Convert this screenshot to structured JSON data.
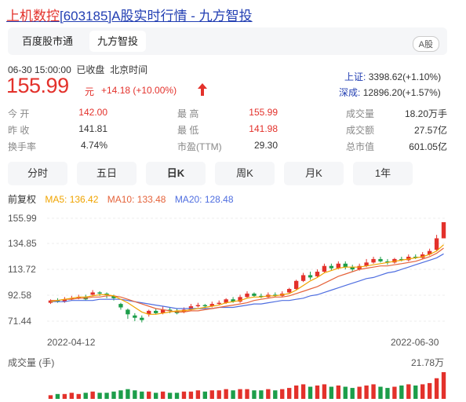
{
  "title": {
    "code_name": "上机数控",
    "bracket": "[603185]A股实时行情 - 九方智投"
  },
  "source_tabs": [
    "百度股市通",
    "九方智投"
  ],
  "market_badge": "A股",
  "quote": {
    "datetime": "06-30 15:00:00",
    "status": "已收盘",
    "timezone": "北京时间",
    "price": "155.99",
    "unit": "元",
    "change": "+14.18 (+10.00%)"
  },
  "indices": [
    {
      "label": "上证:",
      "value": "3398.62(+1.10%)"
    },
    {
      "label": "深成:",
      "value": "12896.20(+1.57%)"
    }
  ],
  "stats": [
    [
      {
        "label": "今  开",
        "value": "142.00",
        "tone": "red"
      },
      {
        "label": "最  高",
        "value": "155.99",
        "tone": "red"
      },
      {
        "label": "成交量",
        "value": "18.20万手",
        "tone": "dark"
      }
    ],
    [
      {
        "label": "昨  收",
        "value": "141.81",
        "tone": "dark"
      },
      {
        "label": "最  低",
        "value": "141.98",
        "tone": "red"
      },
      {
        "label": "成交额",
        "value": "27.57亿",
        "tone": "dark"
      }
    ],
    [
      {
        "label": "换手率",
        "value": "4.74%",
        "tone": "dark"
      },
      {
        "label": "市盈(TTM)",
        "value": "29.30",
        "tone": "dark"
      },
      {
        "label": "总市值",
        "value": "601.05亿",
        "tone": "dark"
      }
    ]
  ],
  "periods": [
    "分时",
    "五日",
    "日K",
    "周K",
    "月K",
    "1年"
  ],
  "active_period": "日K",
  "ma": {
    "adjust": "前复权",
    "ma5": "MA5: 136.42",
    "ma10": "MA10: 133.48",
    "ma20": "MA20: 128.48"
  },
  "colors": {
    "up": "#e3312b",
    "down": "#1c9e4a",
    "ma5": "#f0a400",
    "ma10": "#e5633b",
    "ma20": "#4f6ee0"
  },
  "chart_data": {
    "type": "candlestick",
    "y_ticks": [
      "155.99",
      "134.85",
      "113.72",
      "92.58",
      "71.44"
    ],
    "ylim": [
      71.44,
      155.99
    ],
    "x_labels": [
      "2022-04-12",
      "2022-06-30"
    ],
    "candles": [
      [
        86,
        88,
        89,
        85
      ],
      [
        88,
        87,
        90,
        86
      ],
      [
        87,
        89,
        91,
        86
      ],
      [
        89,
        90,
        92,
        88
      ],
      [
        90,
        91,
        93,
        89
      ],
      [
        91,
        89,
        93,
        88
      ],
      [
        93,
        95,
        97,
        92
      ],
      [
        95,
        94,
        96,
        92
      ],
      [
        94,
        93,
        95,
        90
      ],
      [
        92,
        90,
        93,
        88
      ],
      [
        85,
        82,
        86,
        80
      ],
      [
        80,
        76,
        81,
        72
      ],
      [
        75,
        73,
        77,
        70
      ],
      [
        73,
        71,
        75,
        69
      ],
      [
        76,
        79,
        80,
        74
      ],
      [
        79,
        77,
        81,
        76
      ],
      [
        77,
        80,
        83,
        76
      ],
      [
        80,
        79,
        82,
        77
      ],
      [
        79,
        77,
        81,
        76
      ],
      [
        78,
        80,
        82,
        77
      ],
      [
        80,
        83,
        85,
        79
      ],
      [
        83,
        84,
        86,
        82
      ],
      [
        84,
        83,
        85,
        81
      ],
      [
        83,
        85,
        87,
        82
      ],
      [
        85,
        86,
        88,
        84
      ],
      [
        86,
        89,
        90,
        85
      ],
      [
        89,
        87,
        91,
        86
      ],
      [
        87,
        91,
        93,
        86
      ],
      [
        91,
        94,
        96,
        90
      ],
      [
        94,
        92,
        95,
        91
      ],
      [
        92,
        91,
        94,
        90
      ],
      [
        91,
        93,
        95,
        90
      ],
      [
        93,
        92,
        95,
        91
      ],
      [
        92,
        94,
        96,
        91
      ],
      [
        95,
        98,
        99,
        94
      ],
      [
        98,
        105,
        106,
        97
      ],
      [
        105,
        110,
        112,
        104
      ],
      [
        110,
        108,
        113,
        106
      ],
      [
        109,
        113,
        115,
        108
      ],
      [
        113,
        118,
        120,
        112
      ],
      [
        118,
        116,
        120,
        114
      ],
      [
        116,
        120,
        122,
        115
      ],
      [
        120,
        117,
        122,
        115
      ],
      [
        117,
        115,
        119,
        113
      ],
      [
        115,
        118,
        120,
        114
      ],
      [
        118,
        121,
        124,
        117
      ],
      [
        121,
        124,
        126,
        120
      ],
      [
        124,
        122,
        126,
        121
      ],
      [
        122,
        121,
        124,
        119
      ],
      [
        121,
        124,
        125,
        120
      ],
      [
        124,
        123,
        126,
        122
      ],
      [
        123,
        126,
        128,
        122
      ],
      [
        126,
        125,
        128,
        124
      ],
      [
        125,
        128,
        130,
        124
      ],
      [
        128,
        131,
        133,
        127
      ],
      [
        132,
        142,
        145,
        131
      ],
      [
        142,
        156,
        156,
        142
      ]
    ],
    "ma5": [
      87,
      88,
      89,
      90,
      91,
      91,
      92,
      93,
      93,
      92,
      89,
      86,
      82,
      78,
      76,
      76,
      77,
      78,
      79,
      79,
      80,
      81,
      82,
      83,
      84,
      86,
      87,
      88,
      90,
      91,
      91,
      92,
      92,
      93,
      94,
      97,
      101,
      105,
      108,
      112,
      114,
      116,
      117,
      117,
      117,
      118,
      119,
      120,
      121,
      122,
      123,
      124,
      125,
      126,
      128,
      131,
      136.42
    ],
    "ma10": [
      88,
      88,
      89,
      89,
      90,
      90,
      91,
      91,
      92,
      92,
      91,
      89,
      87,
      85,
      83,
      81,
      80,
      79,
      78,
      78,
      79,
      79,
      80,
      81,
      82,
      83,
      84,
      85,
      86,
      88,
      89,
      90,
      91,
      91,
      92,
      94,
      96,
      98,
      100,
      103,
      106,
      109,
      111,
      113,
      115,
      116,
      117,
      118,
      118,
      119,
      120,
      121,
      122,
      124,
      126,
      129,
      133.48
    ],
    "ma20": [
      87,
      87,
      87,
      88,
      88,
      88,
      88,
      89,
      89,
      89,
      89,
      88,
      87,
      86,
      85,
      84,
      83,
      82,
      81,
      81,
      81,
      81,
      81,
      81,
      82,
      82,
      82,
      83,
      84,
      85,
      85,
      86,
      87,
      88,
      88,
      89,
      90,
      92,
      93,
      95,
      97,
      99,
      101,
      103,
      105,
      107,
      108,
      110,
      112,
      113,
      115,
      117,
      119,
      121,
      123,
      125,
      128.48
    ],
    "volume_label": "成交量 (手)",
    "volume_max_label": "21.78万",
    "volumes": [
      3,
      4,
      4,
      5,
      4,
      5,
      6,
      5,
      5,
      6,
      7,
      8,
      7,
      6,
      6,
      5,
      6,
      5,
      5,
      6,
      6,
      7,
      6,
      7,
      7,
      8,
      7,
      8,
      8,
      7,
      7,
      8,
      7,
      8,
      9,
      11,
      12,
      10,
      11,
      12,
      10,
      11,
      10,
      9,
      10,
      11,
      12,
      10,
      9,
      10,
      11,
      12,
      11,
      12,
      13,
      17,
      22
    ]
  }
}
